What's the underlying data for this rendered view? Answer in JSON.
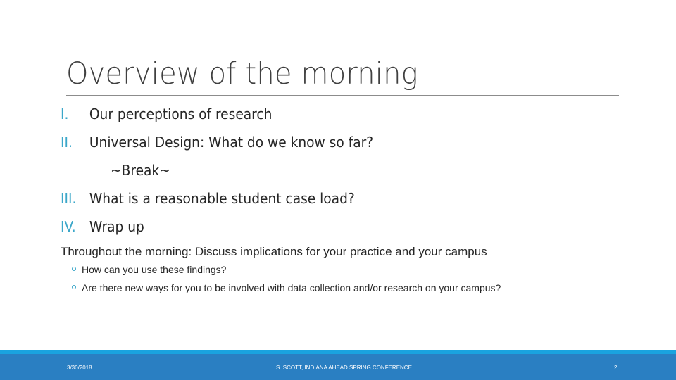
{
  "slide": {
    "title": "Overview of the morning",
    "items": [
      {
        "num": "I.",
        "text": "Our perceptions of research"
      },
      {
        "num": "II.",
        "text": "Universal Design: What do we know so far?"
      },
      {
        "num": "III.",
        "text": "What is a reasonable student case load?"
      },
      {
        "num": "IV.",
        "text": "Wrap up"
      }
    ],
    "break_text": "~Break~",
    "throughout": "Throughout the morning:  Discuss implications for your practice and your campus",
    "sub_bullets": [
      "How can you use these findings?",
      "Are there new ways for you to  be involved with data collection and/or research on your campus?"
    ]
  },
  "footer": {
    "date": "3/30/2018",
    "center": "S. SCOTT, INDIANA AHEAD SPRING CONFERENCE",
    "page": "2"
  },
  "colors": {
    "accent": "#3ba7c9",
    "footer_strip": "#1aa3df",
    "footer_bg": "#2a7fc2"
  }
}
